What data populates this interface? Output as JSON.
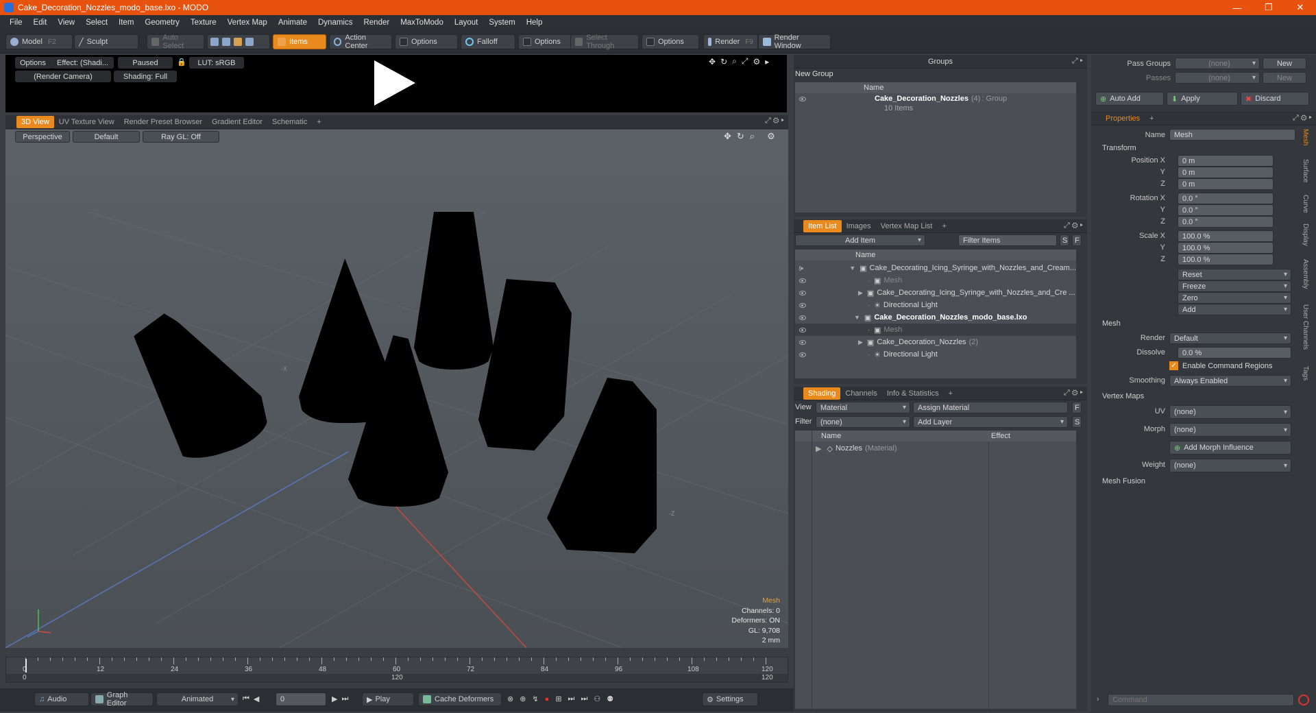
{
  "window": {
    "title": "Cake_Decoration_Nozzles_modo_base.lxo - MODO",
    "controls": [
      "—",
      "❐",
      "✕"
    ]
  },
  "menu": [
    "File",
    "Edit",
    "View",
    "Select",
    "Item",
    "Geometry",
    "Texture",
    "Vertex Map",
    "Animate",
    "Dynamics",
    "Render",
    "MaxToModo",
    "Layout",
    "System",
    "Help"
  ],
  "toolbar": {
    "model": "Model",
    "model_key": "F2",
    "sculpt": "Sculpt",
    "auto_select": "Auto Select",
    "items": "Items",
    "action_center": "Action Center",
    "options1": "Options",
    "falloff": "Falloff",
    "options2": "Options",
    "select_through": "Select Through",
    "options3": "Options",
    "render": "Render",
    "render_key": "F9",
    "render_window": "Render Window"
  },
  "preview": {
    "options": "Options",
    "effect": "Effect: (Shadi...",
    "paused": "Paused",
    "lut": "LUT: sRGB",
    "camera": "(Render Camera)",
    "shading": "Shading: Full"
  },
  "viewport_tabs": [
    "3D View",
    "UV Texture View",
    "Render Preset Browser",
    "Gradient Editor",
    "Schematic",
    "+"
  ],
  "viewport": {
    "perspective": "Perspective",
    "default": "Default",
    "raygl": "Ray GL: Off",
    "axis_x": "-X",
    "axis_z": "-Z"
  },
  "stats": {
    "type": "Mesh",
    "channels": "Channels: 0",
    "deformers": "Deformers: ON",
    "gl": "GL: 9,708",
    "scale": "2 mm"
  },
  "timeline": {
    "ticks": [
      "0",
      "12",
      "24",
      "36",
      "48",
      "60",
      "72",
      "84",
      "96",
      "108",
      "120"
    ],
    "sub_left": "0",
    "sub_mid": "120",
    "sub_right": "120"
  },
  "bottombar": {
    "audio": "Audio",
    "graph_editor": "Graph Editor",
    "animated": "Animated",
    "frame": "0",
    "play": "Play",
    "cache": "Cache Deformers",
    "settings": "Settings"
  },
  "groups": {
    "title": "Groups",
    "new_group": "New Group",
    "col_name": "Name",
    "item_name": "Cake_Decoration_Nozzles",
    "item_count": "(4)",
    "item_type": ": Group",
    "item_sub": "10 Items"
  },
  "itemlist": {
    "tabs": [
      "Item List",
      "Images",
      "Vertex Map List",
      "+"
    ],
    "add_item": "Add Item",
    "filter": "Filter Items",
    "s": "S",
    "f": "F",
    "col_name": "Name",
    "rows": [
      {
        "label": "Cake_Decorating_Icing_Syringe_with_Nozzles_and_Cream...",
        "style": "scene"
      },
      {
        "label": "Mesh",
        "style": "dim"
      },
      {
        "label": "Cake_Decorating_Icing_Syringe_with_Nozzles_and_Cre ...",
        "style": "child"
      },
      {
        "label": "Directional Light",
        "style": "light"
      },
      {
        "label": "Cake_Decoration_Nozzles_modo_base.lxo",
        "style": "scene-bold"
      },
      {
        "label": "Mesh",
        "style": "dim-sel"
      },
      {
        "label": "Cake_Decoration_Nozzles",
        "count": "(2)",
        "style": "child"
      },
      {
        "label": "Directional Light",
        "style": "light"
      }
    ]
  },
  "shading": {
    "tabs": [
      "Shading",
      "Channels",
      "Info & Statistics",
      "+"
    ],
    "view_lbl": "View",
    "view": "Material",
    "assign": "Assign Material",
    "f": "F",
    "filter_lbl": "Filter",
    "filter": "(none)",
    "add_layer": "Add Layer",
    "s": "S",
    "col_name": "Name",
    "col_effect": "Effect",
    "row": "Nozzles",
    "row_type": "(Material)"
  },
  "passes": {
    "pass_groups": "Pass Groups",
    "pass_val": "(none)",
    "new1": "New",
    "passes": "Passes",
    "passes_val": "(none)",
    "new2": "New"
  },
  "actions": {
    "auto_add": "Auto Add",
    "apply": "Apply",
    "discard": "Discard"
  },
  "properties": {
    "tab": "Properties",
    "name_lbl": "Name",
    "name": "Mesh",
    "transform": "Transform",
    "pos_lbl": "Position X",
    "posx": "0 m",
    "posy": "0 m",
    "posz": "0 m",
    "rot_lbl": "Rotation X",
    "rotx": "0.0 °",
    "roty": "0.0 °",
    "rotz": "0.0 °",
    "scl_lbl": "Scale X",
    "sclx": "100.0 %",
    "scly": "100.0 %",
    "sclz": "100.0 %",
    "y": "Y",
    "z": "Z",
    "reset": "Reset",
    "freeze": "Freeze",
    "zero": "Zero",
    "add": "Add",
    "mesh": "Mesh",
    "render_lbl": "Render",
    "render": "Default",
    "dissolve_lbl": "Dissolve",
    "dissolve": "0.0 %",
    "ecr": "Enable Command Regions",
    "smoothing_lbl": "Smoothing",
    "smoothing": "Always Enabled",
    "vmaps": "Vertex Maps",
    "uv_lbl": "UV",
    "uv": "(none)",
    "morph_lbl": "Morph",
    "morph": "(none)",
    "add_morph": "Add Morph Influence",
    "weight_lbl": "Weight",
    "weight": "(none)",
    "mesh_fusion": "Mesh Fusion"
  },
  "side_tabs": [
    "Mesh",
    "Surface",
    "Curve",
    "Display",
    "Assembly",
    "User Channels",
    "Tags"
  ],
  "command": {
    "placeholder": "Command"
  },
  "colors": {
    "accent": "#e98a1f",
    "titlebar": "#e8520f"
  }
}
